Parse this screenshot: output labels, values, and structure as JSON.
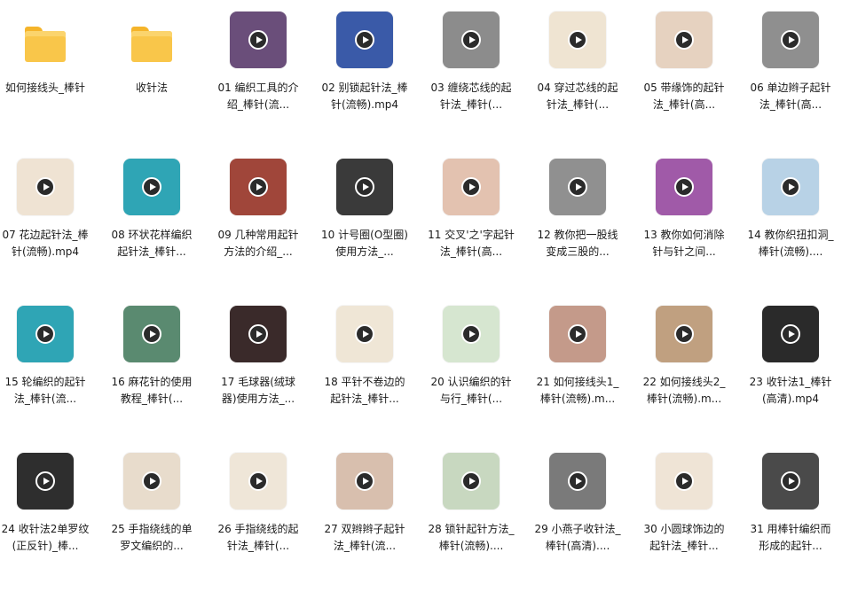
{
  "window_title": "",
  "items": [
    {
      "kind": "folder",
      "label": "如何接线头_棒针",
      "bg": "#f9c64a"
    },
    {
      "kind": "folder",
      "label": "收针法",
      "bg": "#f9c64a"
    },
    {
      "kind": "video",
      "label": "01 编织工具的介绍_棒针(流...",
      "bg": "#6a4e7a"
    },
    {
      "kind": "video",
      "label": "02 别锁起针法_棒针(流畅).mp4",
      "bg": "#3a5aa8"
    },
    {
      "kind": "video",
      "label": "03 缠绕芯线的起针法_棒针(...",
      "bg": "#8c8c8c"
    },
    {
      "kind": "video",
      "label": "04 穿过芯线的起针法_棒针(...",
      "bg": "#efe4d2"
    },
    {
      "kind": "video",
      "label": "05 带缘饰的起针法_棒针(高...",
      "bg": "#e6d2c0"
    },
    {
      "kind": "video",
      "label": "06 单边辫子起针法_棒针(高...",
      "bg": "#8f8f8f"
    },
    {
      "kind": "video",
      "label": "07 花边起针法_棒针(流畅).mp4",
      "bg": "#efe3d3"
    },
    {
      "kind": "video",
      "label": "08 环状花样编织起针法_棒针...",
      "bg": "#2fa5b5"
    },
    {
      "kind": "video",
      "label": "09 几种常用起针方法的介绍_...",
      "bg": "#a0463a"
    },
    {
      "kind": "video",
      "label": "10 计号圈(O型圈)使用方法_...",
      "bg": "#3a3a3a"
    },
    {
      "kind": "video",
      "label": "11 交叉'之'字起针法_棒针(高...",
      "bg": "#e3c2b0"
    },
    {
      "kind": "video",
      "label": "12 教你把一股线变成三股的...",
      "bg": "#909090"
    },
    {
      "kind": "video",
      "label": "13 教你如何消除针与针之间...",
      "bg": "#a05aa8"
    },
    {
      "kind": "video",
      "label": "14 教你织扭扣洞_棒针(流畅)....",
      "bg": "#b8d2e6"
    },
    {
      "kind": "video",
      "label": "15 轮编织的起针法_棒针(流...",
      "bg": "#2fa5b5"
    },
    {
      "kind": "video",
      "label": "16 麻花针的使用教程_棒针(...",
      "bg": "#5a8a70"
    },
    {
      "kind": "video",
      "label": "17 毛球器(绒球器)使用方法_...",
      "bg": "#3a2a2a"
    },
    {
      "kind": "video",
      "label": "18 平针不卷边的起针法_棒针...",
      "bg": "#efe6d6"
    },
    {
      "kind": "video",
      "label": "20 认识编织的针与行_棒针(...",
      "bg": "#d6e6d0"
    },
    {
      "kind": "video",
      "label": "21 如何接线头1_棒针(流畅).m...",
      "bg": "#c49a8a"
    },
    {
      "kind": "video",
      "label": "22 如何接线头2_棒针(流畅).m...",
      "bg": "#c0a080"
    },
    {
      "kind": "video",
      "label": "23 收针法1_棒针(高清).mp4",
      "bg": "#2a2a2a"
    },
    {
      "kind": "video",
      "label": "24 收针法2单罗纹(正反针)_棒...",
      "bg": "#2e2e2e"
    },
    {
      "kind": "video",
      "label": "25 手指绕线的单罗文编织的...",
      "bg": "#e8dccc"
    },
    {
      "kind": "video",
      "label": "26 手指绕线的起针法_棒针(...",
      "bg": "#efe6d8"
    },
    {
      "kind": "video",
      "label": "27 双辫辫子起针法_棒针(流...",
      "bg": "#d8bfae"
    },
    {
      "kind": "video",
      "label": "28 锁针起针方法_棒针(流畅)....",
      "bg": "#c8d8c0"
    },
    {
      "kind": "video",
      "label": "29 小燕子收针法_棒针(高清)....",
      "bg": "#7a7a7a"
    },
    {
      "kind": "video",
      "label": "30 小圆球饰边的起针法_棒针...",
      "bg": "#efe4d6"
    },
    {
      "kind": "video",
      "label": "31 用棒针编织而形成的起针...",
      "bg": "#4a4a4a"
    }
  ]
}
